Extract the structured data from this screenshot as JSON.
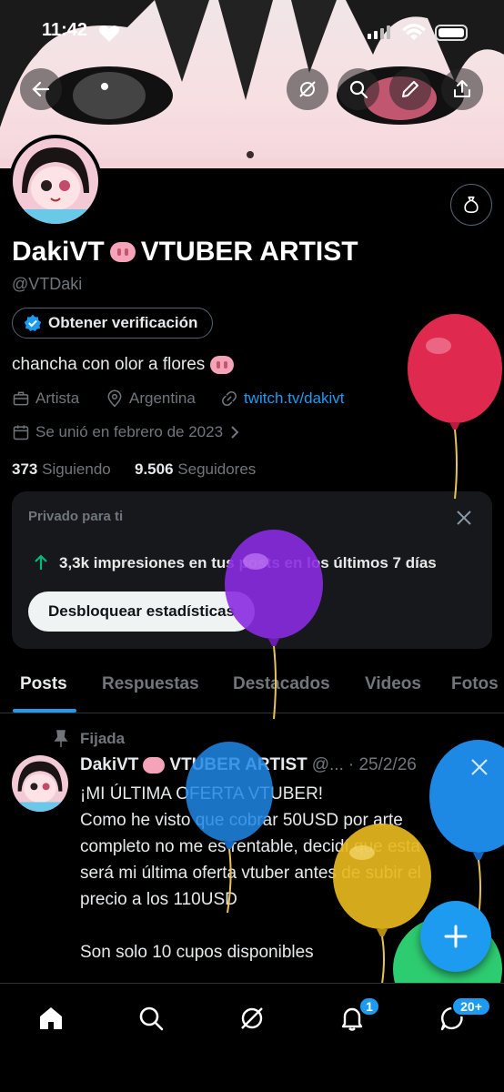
{
  "status_bar": {
    "time": "11:42"
  },
  "profile": {
    "name": "DakiVT",
    "name_suffix": "VTUBER ARTIST",
    "handle": "@VTDaki",
    "verify_label": "Obtener verificación",
    "bio": "chancha con olor a flores",
    "category": "Artista",
    "location": "Argentina",
    "link": "twitch.tv/dakivt",
    "joined": "Se unió en febrero de 2023",
    "following_count": "373",
    "following_label": "Siguiendo",
    "followers_count": "9.506",
    "followers_label": "Seguidores"
  },
  "insights_card": {
    "heading": "Privado para ti",
    "impressions": "3,3k impresiones en tus posts en los últimos 7 días",
    "unlock_label": "Desbloquear estadísticas"
  },
  "tabs": [
    "Posts",
    "Respuestas",
    "Destacados",
    "Videos",
    "Fotos"
  ],
  "pinned_post": {
    "pinned_label": "Fijada",
    "author": "DakiVT",
    "author_suffix": "VTUBER ARTIST",
    "handle_trunc": "@...",
    "date": "· 25/2/26",
    "lines": [
      "¡MI ÚLTIMA OFERTA VTUBER!",
      "Como he visto que cobrar 50USD por arte",
      "completo no me es rentable, decidí que esta",
      "será mi última oferta vtuber antes de subir el",
      "precio a los 110USD",
      "",
      "Son solo 10 cupos disponibles"
    ]
  },
  "bottom_nav": {
    "notifications_badge": "1",
    "messages_badge": "20+"
  },
  "colors": {
    "accent": "#1d9bf0",
    "background": "#000000",
    "card": "#16181c"
  }
}
